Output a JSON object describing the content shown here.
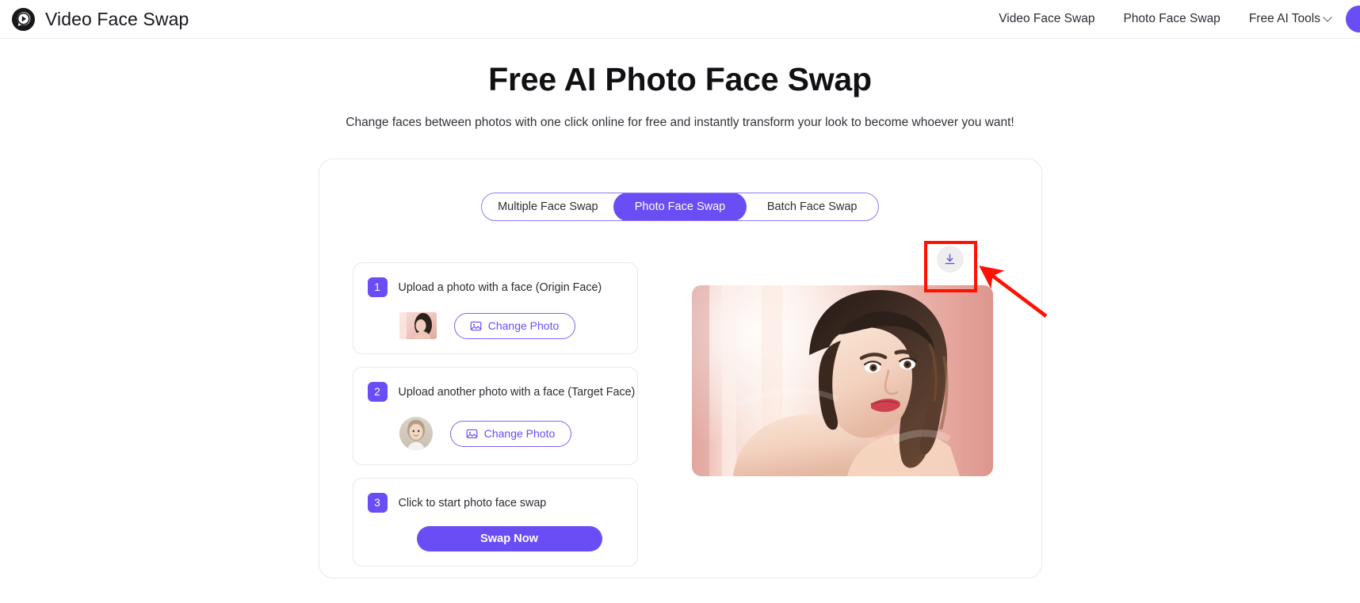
{
  "header": {
    "brand_name": "Video Face Swap",
    "logo_icon": "face-swap-logo-icon",
    "nav": [
      {
        "label": "Video Face Swap",
        "icon": null
      },
      {
        "label": "Photo Face Swap",
        "icon": null
      },
      {
        "label": "Free AI Tools",
        "icon": "chevron-down-icon"
      }
    ],
    "avatar_label": ""
  },
  "hero": {
    "title": "Free AI Photo Face Swap",
    "subtitle": "Change faces between photos with one click online for free and instantly transform your look to become whoever you want!"
  },
  "tabs": [
    {
      "label": "Multiple Face Swap",
      "active": false
    },
    {
      "label": "Photo Face Swap",
      "active": true
    },
    {
      "label": "Batch Face Swap",
      "active": false
    }
  ],
  "steps": [
    {
      "number": "1",
      "label": "Upload a photo with a face  (Origin Face)",
      "thumb": "origin-face-thumbnail",
      "button": {
        "label": "Change Photo",
        "icon": "image-icon"
      }
    },
    {
      "number": "2",
      "label": "Upload another photo with a face  (Target Face)",
      "thumb": "target-face-thumbnail",
      "button": {
        "label": "Change Photo",
        "icon": "image-icon"
      }
    },
    {
      "number": "3",
      "label": "Click to start photo face swap",
      "button": {
        "label": "Swap Now"
      }
    }
  ],
  "result": {
    "download_icon": "download-icon",
    "image_alt": "swapped-result-photo"
  },
  "colors": {
    "accent": "#6b4df6",
    "accent_border": "#7d63f7",
    "annotation_red": "#fe1100",
    "card_border": "#e9e9ee",
    "text": "#2a2c32"
  }
}
